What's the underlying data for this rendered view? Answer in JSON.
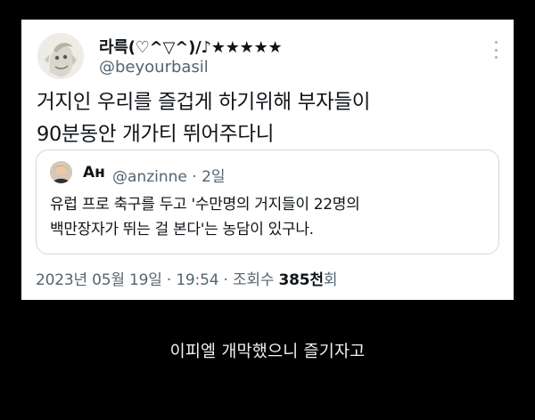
{
  "tweet": {
    "author": {
      "display_name": "라륵(♡^▽^)/♪★★★★★",
      "handle": "@beyourbasil",
      "avatar_icon": "cartoon-character-avatar"
    },
    "more_icon": "more-options-icon",
    "text": "거지인 우리를 즐겁게 하기위해 부자들이\n90분동안 개가티 뛰어주다니",
    "quote": {
      "name": "Ан",
      "handle": "@anzinne",
      "separator": "·",
      "time": "2일",
      "avatar_icon": "person-photo-avatar",
      "text": "유럽 프로 축구를 두고 '수만명의 거지들이 22명의\n백만장자가 뛰는 걸 본다'는 농담이 있구나."
    },
    "meta": {
      "date": "2023년 05월 19일",
      "dot1": "·",
      "time": "19:54",
      "dot2": "·",
      "views_label": "조회수",
      "views_value": "385천",
      "views_suffix": "회"
    }
  },
  "caption": "이피엘 개막했으니 즐기자고",
  "colors": {
    "background": "#000000",
    "card": "#ffffff",
    "text_primary": "#0f1419",
    "text_secondary": "#536471",
    "border": "#cfd9de"
  }
}
